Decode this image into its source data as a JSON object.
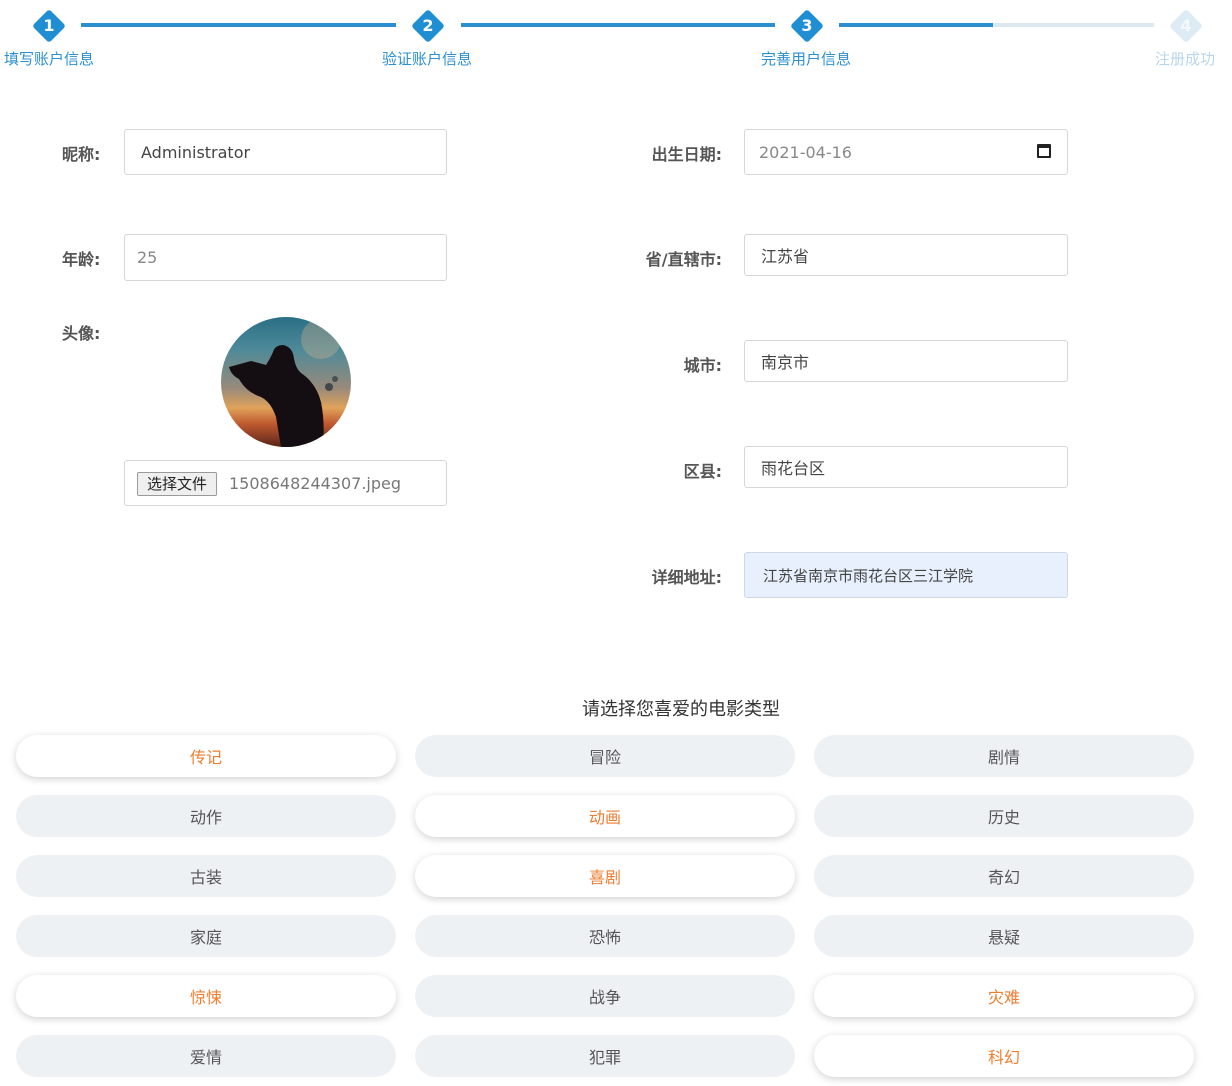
{
  "stepper": {
    "steps": [
      {
        "num": "1",
        "label": "填写账户信息"
      },
      {
        "num": "2",
        "label": "验证账户信息"
      },
      {
        "num": "3",
        "label": "完善用户信息"
      },
      {
        "num": "4",
        "label": "注册成功"
      }
    ]
  },
  "form": {
    "nickname": {
      "label": "昵称:",
      "value": "Administrator"
    },
    "age": {
      "label": "年龄:",
      "value": "25"
    },
    "avatar": {
      "label": "头像:",
      "button_label": "选择文件",
      "file_name": "1508648244307.jpeg"
    },
    "birthdate": {
      "label": "出生日期:",
      "value": "2021-04-16"
    },
    "province": {
      "label": "省/直辖市:",
      "value": "江苏省"
    },
    "city": {
      "label": "城市:",
      "value": "南京市"
    },
    "district": {
      "label": "区县:",
      "value": "雨花台区"
    },
    "address": {
      "label": "详细地址:",
      "value": "江苏省南京市雨花台区三江学院"
    }
  },
  "genres": {
    "heading": "请选择您喜爱的电影类型",
    "items": [
      {
        "label": "传记",
        "selected": true
      },
      {
        "label": "冒险",
        "selected": false
      },
      {
        "label": "剧情",
        "selected": false
      },
      {
        "label": "动作",
        "selected": false
      },
      {
        "label": "动画",
        "selected": true
      },
      {
        "label": "历史",
        "selected": false
      },
      {
        "label": "古装",
        "selected": false
      },
      {
        "label": "喜剧",
        "selected": true
      },
      {
        "label": "奇幻",
        "selected": false
      },
      {
        "label": "家庭",
        "selected": false
      },
      {
        "label": "恐怖",
        "selected": false
      },
      {
        "label": "悬疑",
        "selected": false
      },
      {
        "label": "惊悚",
        "selected": true
      },
      {
        "label": "战争",
        "selected": false
      },
      {
        "label": "灾难",
        "selected": true
      },
      {
        "label": "爱情",
        "selected": false
      },
      {
        "label": "犯罪",
        "selected": false
      },
      {
        "label": "科幻",
        "selected": true
      }
    ]
  },
  "colors": {
    "primary": "#1f8ed3",
    "accent_selected": "#ef7d2f",
    "chip_bg": "#eef1f4"
  }
}
